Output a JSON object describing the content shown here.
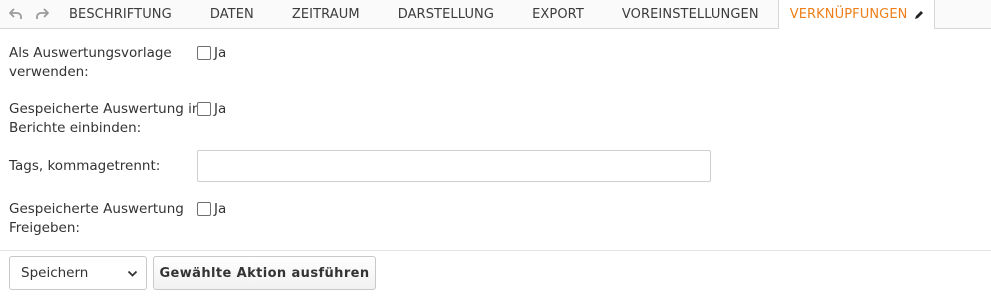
{
  "tabs": [
    {
      "label": "BESCHRIFTUNG",
      "active": false
    },
    {
      "label": "DATEN",
      "active": false
    },
    {
      "label": "ZEITRAUM",
      "active": false
    },
    {
      "label": "DARSTELLUNG",
      "active": false
    },
    {
      "label": "EXPORT",
      "active": false
    },
    {
      "label": "VOREINSTELLUNGEN",
      "active": false
    },
    {
      "label": "VERKNÜPFUNGEN",
      "active": true
    }
  ],
  "form": {
    "template": {
      "label_line1": "Als Auswertungsvorlage",
      "label_line2": "verwenden:",
      "option": "Ja",
      "checked": false
    },
    "include_reports": {
      "label_line1": "Gespeicherte Auswertung in",
      "label_line2": "Berichte einbinden:",
      "option": "Ja",
      "checked": false
    },
    "tags": {
      "label": "Tags, kommagetrennt:",
      "value": "",
      "placeholder": ""
    },
    "share": {
      "label_line1": "Gespeicherte Auswertung",
      "label_line2": "Freigeben:",
      "option": "Ja",
      "checked": false
    }
  },
  "footer": {
    "action_select_value": "Speichern",
    "execute_label": "Gewählte Aktion ausführen"
  },
  "colors": {
    "active_tab": "#ee7f1a",
    "text": "#333333",
    "border": "#d6d6d6"
  }
}
